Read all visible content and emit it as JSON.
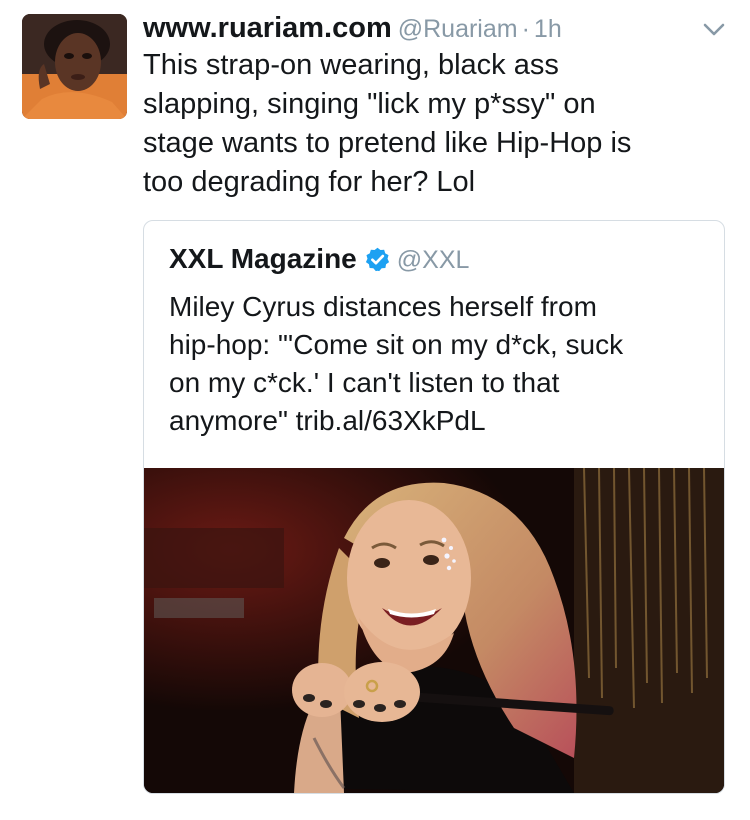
{
  "tweet": {
    "display_name": "www.ruariam.com",
    "handle": "@Ruariam",
    "separator": "·",
    "time": "1h",
    "text_lines": [
      "This strap-on wearing, black ass",
      "slapping, singing \"lick my p*ssy\" on",
      "stage wants to pretend like Hip-Hop is",
      "too degrading for her? Lol"
    ],
    "avatar_icon": "profile-photo",
    "menu_icon": "chevron-down-icon"
  },
  "quoted_tweet": {
    "display_name": "XXL Magazine",
    "verified_icon": "verified-badge-icon",
    "handle": "@XXL",
    "text_lines": [
      "Miley Cyrus distances herself from",
      "hip-hop: \"'Come sit on my d*ck, suck",
      "on my c*ck.' I can't listen to that",
      "anymore\" trib.al/63XkPdL"
    ],
    "media_icon": "photo"
  },
  "colors": {
    "text": "#14171a",
    "secondary": "#8899a6",
    "verified": "#1da1f2",
    "border": "#d6dde3"
  }
}
